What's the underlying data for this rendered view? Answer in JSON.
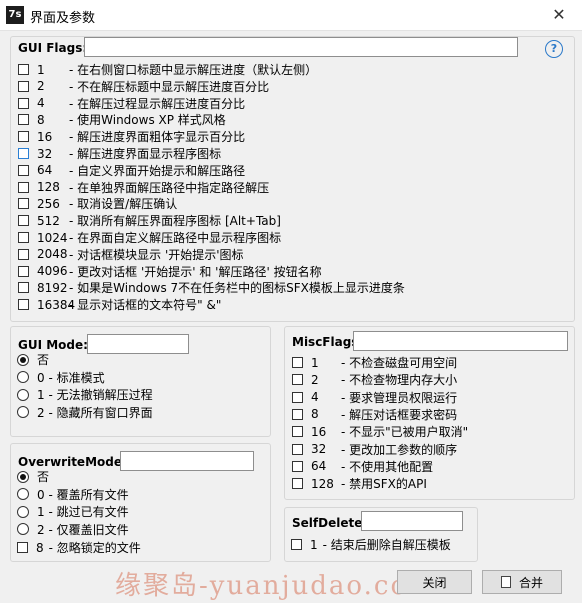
{
  "window": {
    "app_icon": "7s",
    "title": "界面及参数",
    "close_glyph": "✕"
  },
  "gui_flags": {
    "label": "GUI Flags:",
    "value": "",
    "help_glyph": "?",
    "items": [
      {
        "num": "1",
        "text": "- 在右侧窗口标题中显示解压进度（默认左侧）",
        "checked": false
      },
      {
        "num": "2",
        "text": "- 不在解压标题中显示解压进度百分比",
        "checked": false
      },
      {
        "num": "4",
        "text": "- 在解压过程显示解压进度百分比",
        "checked": false
      },
      {
        "num": "8",
        "text": "- 使用Windows XP 样式风格",
        "checked": false
      },
      {
        "num": "16",
        "text": "-  解压进度界面粗体字显示百分比",
        "checked": false
      },
      {
        "num": "32",
        "text": "-  解压进度界面显示程序图标",
        "checked": false
      },
      {
        "num": "64",
        "text": "- 自定义界面开始提示和解压路径",
        "checked": false
      },
      {
        "num": "128",
        "text": "- 在单独界面解压路径中指定路径解压",
        "checked": false
      },
      {
        "num": "256",
        "text": "- 取消设置/解压确认",
        "checked": false
      },
      {
        "num": "512",
        "text": "- 取消所有解压界面程序图标 [Alt+Tab]",
        "checked": false
      },
      {
        "num": "1024",
        "text": "-  在界面自定义解压路径中显示程序图标",
        "checked": false
      },
      {
        "num": "2048",
        "text": "- 对话框模块显示 '开始提示'图标",
        "checked": false
      },
      {
        "num": "4096",
        "text": "- 更改对话框 '开始提示' 和 '解压路径' 按钮名称",
        "checked": false
      },
      {
        "num": "8192",
        "text": "- 如果是Windows 7不在任务栏中的图标SFX模板上显示进度条",
        "checked": false
      },
      {
        "num": "16384",
        "text": "- 显示对话框的文本符号\" &\"",
        "checked": false
      }
    ]
  },
  "gui_mode": {
    "label": "GUI Mode:",
    "value": "",
    "options": [
      {
        "text": "否",
        "selected": true
      },
      {
        "text": "0 - 标准模式",
        "selected": false
      },
      {
        "text": "1 - 无法撤销解压过程",
        "selected": false
      },
      {
        "text": "2 - 隐藏所有窗口界面",
        "selected": false
      }
    ]
  },
  "overwrite_mode": {
    "label": "OverwriteMode:",
    "value": "",
    "options": [
      {
        "text": "否",
        "selected": true
      },
      {
        "text": "0 - 覆盖所有文件",
        "selected": false
      },
      {
        "text": "1 - 跳过已有文件",
        "selected": false
      },
      {
        "text": "2 - 仅覆盖旧文件",
        "selected": false
      }
    ],
    "extra": {
      "num": "8",
      "text": "- 忽略锁定的文件",
      "checked": false
    }
  },
  "misc_flags": {
    "label": "MiscFlags:",
    "value": "",
    "items": [
      {
        "num": "1",
        "text": "- 不检查磁盘可用空间",
        "checked": false
      },
      {
        "num": "2",
        "text": "- 不检查物理内存大小",
        "checked": false
      },
      {
        "num": "4",
        "text": "- 要求管理员权限运行",
        "checked": false
      },
      {
        "num": "8",
        "text": "- 解压对话框要求密码",
        "checked": false
      },
      {
        "num": "16",
        "text": "- 不显示\"已被用户取消\"",
        "checked": false
      },
      {
        "num": "32",
        "text": "- 更改加工参数的顺序",
        "checked": false
      },
      {
        "num": "64",
        "text": "- 不使用其他配置",
        "checked": false
      },
      {
        "num": "128",
        "text": "- 禁用SFX的API",
        "checked": false
      }
    ]
  },
  "self_delete": {
    "label": "SelfDelete:",
    "value": "",
    "item": {
      "num": "1",
      "text": "- 结束后删除自解压模板",
      "checked": false
    }
  },
  "buttons": {
    "close": "关闭",
    "merge": "合并"
  },
  "watermark": "缘聚岛-yuanjudao.com"
}
